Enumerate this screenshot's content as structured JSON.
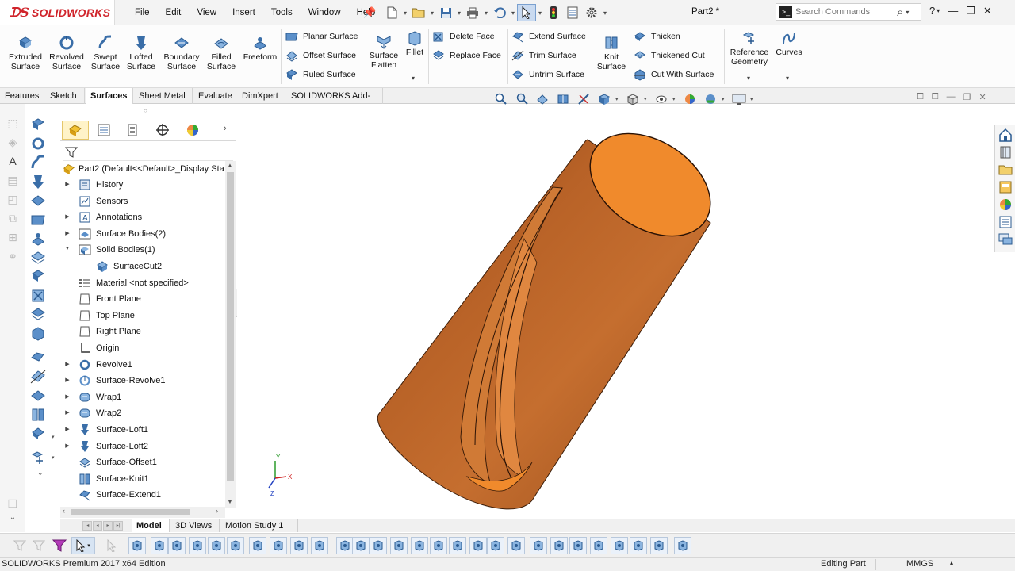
{
  "app": {
    "brand": "SOLIDWORKS",
    "document_title": "Part2 *"
  },
  "menu": [
    "File",
    "Edit",
    "View",
    "Insert",
    "Tools",
    "Window",
    "Help"
  ],
  "search": {
    "placeholder": "Search Commands"
  },
  "ribbon": {
    "big_buttons": [
      {
        "label": "Extruded\nSurface",
        "icon": "extruded-surface-icon"
      },
      {
        "label": "Revolved\nSurface",
        "icon": "revolved-surface-icon"
      },
      {
        "label": "Swept\nSurface",
        "icon": "swept-surface-icon"
      },
      {
        "label": "Lofted\nSurface",
        "icon": "lofted-surface-icon"
      },
      {
        "label": "Boundary\nSurface",
        "icon": "boundary-surface-icon"
      },
      {
        "label": "Filled\nSurface",
        "icon": "filled-surface-icon"
      },
      {
        "label": "Freeform",
        "icon": "freeform-icon"
      }
    ],
    "group1": [
      "Planar Surface",
      "Offset Surface",
      "Ruled Surface"
    ],
    "surface_flatten": "Surface\nFlatten",
    "fillet": "Fillet",
    "group2": [
      "Delete Face",
      "Replace Face"
    ],
    "group3": [
      "Extend Surface",
      "Trim Surface",
      "Untrim Surface"
    ],
    "knit": "Knit\nSurface",
    "group4": [
      "Thicken",
      "Thickened Cut",
      "Cut With Surface"
    ],
    "reference_geometry": "Reference\nGeometry",
    "curves": "Curves"
  },
  "tabs": [
    "Features",
    "Sketch",
    "Surfaces",
    "Sheet Metal",
    "Evaluate",
    "DimXpert",
    "SOLIDWORKS Add-Ins"
  ],
  "active_tab": "Surfaces",
  "tree": {
    "root": "Part2  (Default<<Default>_Display Sta",
    "nodes": [
      {
        "label": "History",
        "arrow": "collapsed",
        "icon": "history-icon",
        "indent": 0
      },
      {
        "label": "Sensors",
        "arrow": "",
        "icon": "sensors-icon",
        "indent": 0
      },
      {
        "label": "Annotations",
        "arrow": "collapsed",
        "icon": "annotations-icon",
        "indent": 0
      },
      {
        "label": "Surface Bodies(2)",
        "arrow": "collapsed",
        "icon": "surface-bodies-icon",
        "indent": 0
      },
      {
        "label": "Solid Bodies(1)",
        "arrow": "expanded",
        "icon": "solid-bodies-icon",
        "indent": 0
      },
      {
        "label": "SurfaceCut2",
        "arrow": "",
        "icon": "solid-body-icon",
        "indent": 1
      },
      {
        "label": "Material <not specified>",
        "arrow": "",
        "icon": "material-icon",
        "indent": 0
      },
      {
        "label": "Front Plane",
        "arrow": "",
        "icon": "plane-icon",
        "indent": 0
      },
      {
        "label": "Top Plane",
        "arrow": "",
        "icon": "plane-icon",
        "indent": 0
      },
      {
        "label": "Right Plane",
        "arrow": "",
        "icon": "plane-icon",
        "indent": 0
      },
      {
        "label": "Origin",
        "arrow": "",
        "icon": "origin-icon",
        "indent": 0
      },
      {
        "label": "Revolve1",
        "arrow": "collapsed",
        "icon": "revolve-icon",
        "indent": 0
      },
      {
        "label": "Surface-Revolve1",
        "arrow": "collapsed",
        "icon": "surface-revolve-icon",
        "indent": 0
      },
      {
        "label": "Wrap1",
        "arrow": "collapsed",
        "icon": "wrap-icon",
        "indent": 0
      },
      {
        "label": "Wrap2",
        "arrow": "collapsed",
        "icon": "wrap-icon",
        "indent": 0
      },
      {
        "label": "Surface-Loft1",
        "arrow": "collapsed",
        "icon": "surface-loft-icon",
        "indent": 0
      },
      {
        "label": "Surface-Loft2",
        "arrow": "collapsed",
        "icon": "surface-loft-icon",
        "indent": 0
      },
      {
        "label": "Surface-Offset1",
        "arrow": "",
        "icon": "surface-offset-icon",
        "indent": 0
      },
      {
        "label": "Surface-Knit1",
        "arrow": "",
        "icon": "surface-knit-icon",
        "indent": 0
      },
      {
        "label": "Surface-Extend1",
        "arrow": "",
        "icon": "surface-extend-icon",
        "indent": 0
      }
    ]
  },
  "bottom_tabs": [
    "Model",
    "3D Views",
    "Motion Study 1"
  ],
  "active_bottom_tab": "Model",
  "status": {
    "edition": "SOLIDWORKS Premium 2017 x64 Edition",
    "mode": "Editing Part",
    "units": "MMGS"
  },
  "triad": {
    "x": "X",
    "y": "Y",
    "z": "Z"
  },
  "colors": {
    "brand_red": "#d0242b",
    "body_copper": "#b5602a",
    "face_orange": "#f08a2c",
    "accent_blue": "#1b6fc2"
  }
}
